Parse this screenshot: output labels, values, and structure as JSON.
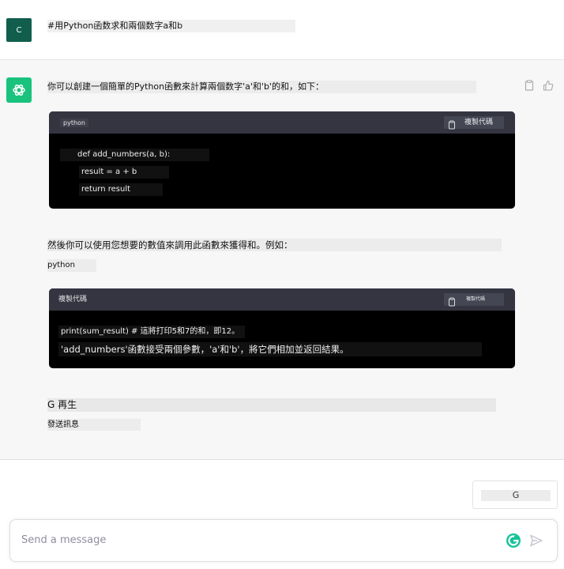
{
  "user": {
    "avatar_letter": "C",
    "message": "#用Python函数求和兩個数字a和b"
  },
  "assistant": {
    "intro": "你可以創建一個簡單的Python函數來計算兩個数字'a'和'b'的和，如下：",
    "code1": {
      "lang": "python",
      "copy_label": "複製代碼",
      "lines": [
        "def add_numbers(a, b):",
        "result = a + b",
        "return result"
      ]
    },
    "then_text": "然後你可以使用您想要的數值來調用此函數來獲得和。例如：",
    "python_label": "python",
    "code2": {
      "lang": "複製代碼",
      "copy_label": "複製代碼",
      "lines": [
        "print(sum_result) # 這將打印5和7的和，即12。",
        "'add_numbers'函數接受兩個參數，'a'和'b'，將它們相加並返回結果。"
      ]
    },
    "regen_label": "G 再生",
    "send_label": "發送訊息"
  },
  "bottom": {
    "g_button_label": "G",
    "input_placeholder": "Send a message"
  },
  "colors": {
    "user_avatar": "#115e4d",
    "gpt_avatar": "#19c37d",
    "code_bg": "#000000",
    "code_header": "#343541"
  }
}
